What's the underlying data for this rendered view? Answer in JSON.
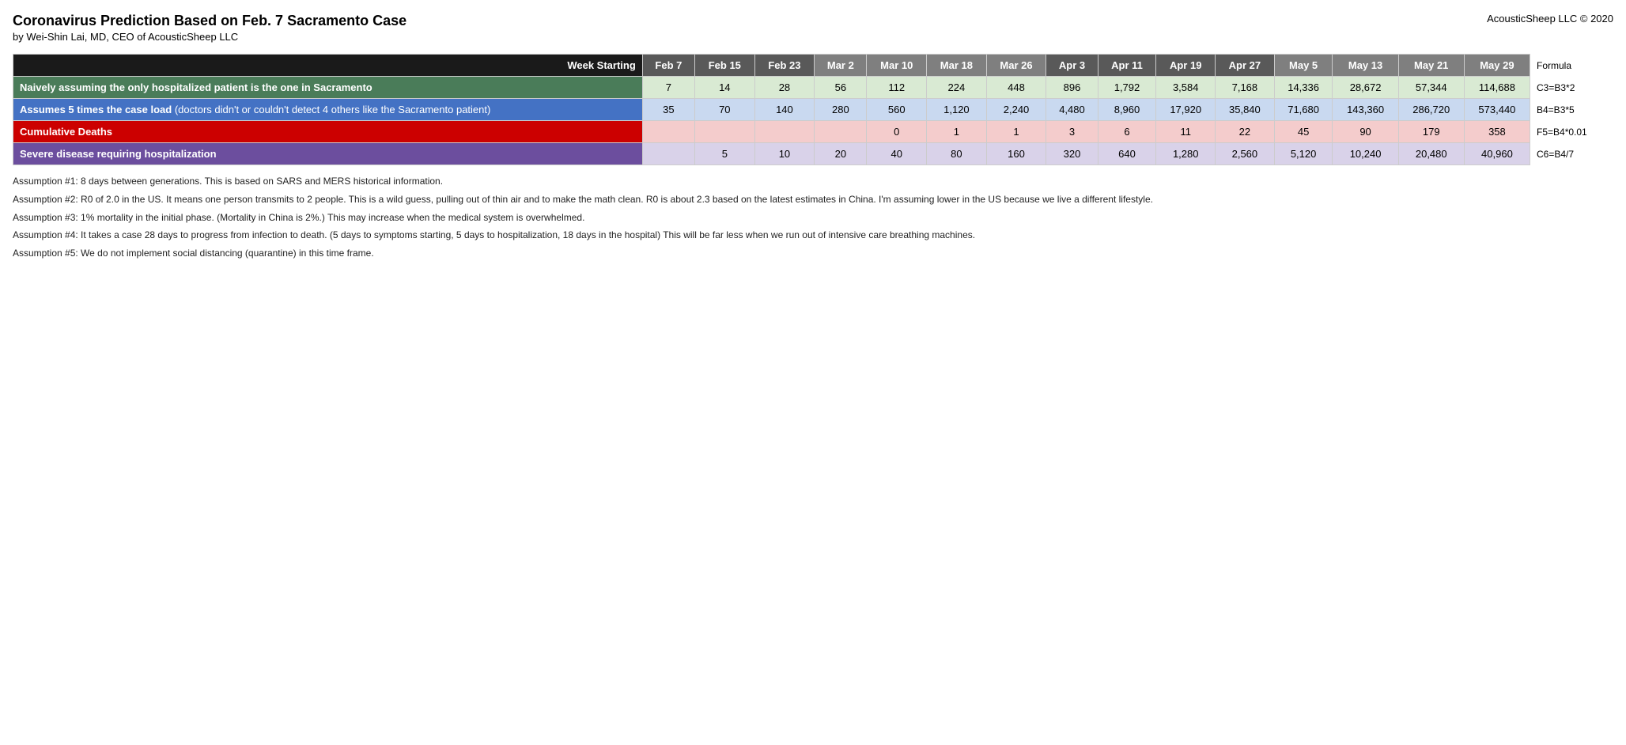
{
  "title": "Coronavirus Prediction Based on Feb. 7 Sacramento Case",
  "subtitle": "by Wei-Shin Lai, MD, CEO of AcousticSheep LLC",
  "copyright": "AcousticSheep LLC © 2020",
  "header": {
    "label": "Week Starting",
    "columns": [
      "Feb 7",
      "Feb 15",
      "Feb 23",
      "Mar 2",
      "Mar 10",
      "Mar 18",
      "Mar 26",
      "Apr 3",
      "Apr 11",
      "Apr 19",
      "Apr 27",
      "May 5",
      "May 13",
      "May 21",
      "May 29"
    ],
    "formula_col": "Formula"
  },
  "rows": [
    {
      "id": "row1",
      "label": "Naively assuming the only hospitalized patient is the one in Sacramento",
      "formula": "C3=B3*2",
      "values": [
        "7",
        "14",
        "28",
        "56",
        "112",
        "224",
        "448",
        "896",
        "1,792",
        "3,584",
        "7,168",
        "14,336",
        "28,672",
        "57,344",
        "114,688"
      ]
    },
    {
      "id": "row2",
      "label_bold": "Assumes 5 times the case load",
      "label_normal": " (doctors didn't or couldn't detect 4 others like the Sacramento patient)",
      "formula": "B4=B3*5",
      "values": [
        "35",
        "70",
        "140",
        "280",
        "560",
        "1,120",
        "2,240",
        "4,480",
        "8,960",
        "17,920",
        "35,840",
        "71,680",
        "143,360",
        "286,720",
        "573,440"
      ]
    },
    {
      "id": "row3",
      "label": "Cumulative Deaths",
      "formula": "F5=B4*0.01",
      "values": [
        "",
        "",
        "",
        "",
        "0",
        "1",
        "1",
        "3",
        "6",
        "11",
        "22",
        "45",
        "90",
        "179",
        "358"
      ]
    },
    {
      "id": "row4",
      "label": "Severe disease requiring hospitalization",
      "formula": "C6=B4/7",
      "values": [
        "",
        "5",
        "10",
        "20",
        "40",
        "80",
        "160",
        "320",
        "640",
        "1,280",
        "2,560",
        "5,120",
        "10,240",
        "20,480",
        "40,960"
      ]
    }
  ],
  "assumptions": [
    "Assumption #1: 8 days between generations. This is based on SARS and MERS historical information.",
    "Assumption #2: R0 of 2.0 in the US. It means one person transmits to 2 people. This is a wild guess, pulling out of thin air and to make the math clean. R0 is about 2.3 based on the latest estimates in China. I'm assuming lower in the US because we live a different lifestyle.",
    "Assumption #3: 1% mortality in the initial phase. (Mortality in China is 2%.) This may increase when the medical system is overwhelmed.",
    "Assumption #4: It takes a case 28 days to progress from infection to death. (5 days to symptoms starting, 5 days to hospitalization, 18 days in the hospital) This will be far less when we run out of intensive care breathing machines.",
    "Assumption #5: We do not implement social distancing (quarantine)  in this time frame."
  ]
}
